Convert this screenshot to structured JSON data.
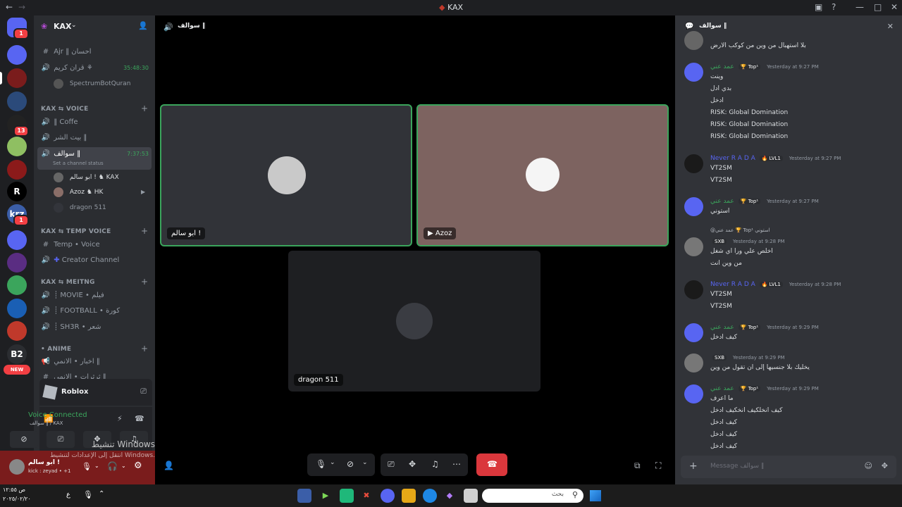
{
  "window": {
    "title": "KAX"
  },
  "rail": {
    "servers": [
      {
        "label": "",
        "badge": "1",
        "color": "#5865f2"
      },
      {
        "label": "",
        "badge": "",
        "color": "#5865f2"
      },
      {
        "label": "",
        "badge": "",
        "color": "#7a1c1c"
      },
      {
        "label": "",
        "badge": "",
        "color": "#2b4a7a"
      },
      {
        "label": "",
        "badge": "13",
        "color": "#222"
      },
      {
        "label": "",
        "badge": "",
        "color": "#8fbf62"
      },
      {
        "label": "",
        "badge": "",
        "color": "#8b1a1a"
      },
      {
        "label": "R",
        "badge": "",
        "color": "#000"
      },
      {
        "label": "krz",
        "badge": "1",
        "color": "#3b5ea8"
      },
      {
        "label": "",
        "badge": "",
        "color": "#5865f2"
      },
      {
        "label": "",
        "badge": "",
        "color": "#5a2d82"
      },
      {
        "label": "",
        "badge": "",
        "color": "#3ba55c"
      },
      {
        "label": "",
        "badge": "",
        "color": "#1a5fb4"
      },
      {
        "label": "",
        "badge": "",
        "color": "#c0392b"
      },
      {
        "label": "B2",
        "badge": "",
        "color": "#2b2d31"
      }
    ],
    "new_label": "NEW"
  },
  "sidebar": {
    "guild_name": "KAX",
    "channels_top": [
      {
        "icon": "#",
        "name": "Ajr ‖ احسان"
      },
      {
        "icon": "voice",
        "name": "قران كريم ⚘",
        "time": "35:48:30"
      },
      {
        "icon": "member",
        "name": "SpectrumBotQuran"
      }
    ],
    "cat_voice": "KAX ⇆ VOICE",
    "voice_channels": [
      {
        "name": "‖ Coffe"
      },
      {
        "name": "بيت الشر ‖"
      },
      {
        "name": "سوالف ‖",
        "time": "7:37:53",
        "status": "Set a channel status"
      }
    ],
    "voice_members": [
      {
        "name": "ابو سالم ! ♞ KAX"
      },
      {
        "name": "Azoz ♞ HK"
      },
      {
        "name": "dragon 511"
      }
    ],
    "cat_temp": "KAX ⇆ TEMP VOICE",
    "temp_channels": [
      {
        "icon": "#",
        "name": "Temp • Voice"
      },
      {
        "icon": "+",
        "name": "Creator Channel"
      }
    ],
    "cat_meeting": "KAX ⇆ MEITNG",
    "meeting_channels": [
      {
        "name": "┊ MOVIE • فيلم"
      },
      {
        "name": "┊ FOOTBALL • كورة"
      },
      {
        "name": "┊ SH3R • شعر"
      }
    ],
    "cat_anime": "• ANIME",
    "anime_channels": [
      {
        "name": "اخبار • الانمي ‖"
      },
      {
        "name": "ثرثرات • الانمي ‖"
      }
    ]
  },
  "activity": {
    "game": "Roblox"
  },
  "voice_panel": {
    "status": "Voice Connected",
    "location": "سوالف ‖ / KAX"
  },
  "windows_watermark": {
    "line1": "تنشيط Windows",
    "line2": "انتقل إلى الإعدادات لتنشيط Windows."
  },
  "user_panel": {
    "name": "ابو سالم !",
    "status": "kick : zeyad • +1"
  },
  "call": {
    "header": "سوالف ‖",
    "tiles": [
      {
        "name": "ابو سالم !"
      },
      {
        "name": "Azoz"
      },
      {
        "name": "dragon 511"
      }
    ]
  },
  "chat": {
    "header": "سوالف ‖",
    "input_placeholder": "Message سوالف ‖",
    "messages": [
      {
        "author": "",
        "time": "",
        "lines": [
          "بلا استهبال من وين من كوكب الارض"
        ]
      },
      {
        "author": "عمد عني",
        "tag": "🏆 Top¹",
        "time": "Yesterday at 9:27 PM",
        "lines": [
          "وينت",
          "بدي ادل",
          "ادخل",
          "RISK: Global Domination",
          "RISK: Global Domination",
          "RISK: Global Domination"
        ]
      },
      {
        "author": "Never R A D A",
        "tag": "🔥 LVL1",
        "time": "Yesterday at 9:27 PM",
        "lines": [
          "VT2SM",
          "VT2SM"
        ]
      },
      {
        "author": "عمد عني",
        "tag": "🏆 Top¹",
        "time": "Yesterday at 9:27 PM",
        "lines": [
          "استوني"
        ]
      },
      {
        "reply": "@عمد عني 🏆 Top¹ استوني",
        "author": "",
        "tag": "SXB",
        "time": "Yesterday at 9:28 PM",
        "lines": [
          "اخلص علي ورا اي شغل",
          "من وين انت"
        ]
      },
      {
        "author": "Never R A D A",
        "tag": "🔥 LVL1",
        "time": "Yesterday at 9:28 PM",
        "lines": [
          "VT2SM",
          "VT2SM"
        ]
      },
      {
        "author": "عمد عني",
        "tag": "🏆 Top¹",
        "time": "Yesterday at 9:29 PM",
        "lines": [
          "كيف ادخل"
        ]
      },
      {
        "author": "",
        "tag": "SXB",
        "time": "Yesterday at 9:29 PM",
        "lines": [
          "يخليك بلا جنسيها إلى ان تقول من وين"
        ]
      },
      {
        "author": "عمد عني",
        "tag": "🏆 Top¹",
        "time": "Yesterday at 9:29 PM",
        "lines": [
          "ما اعرف",
          "كيف انخلكيف انخكيف ادخل",
          "كيف ادخل",
          "كيف ادخل",
          "كيف ادخل"
        ]
      }
    ]
  },
  "taskbar": {
    "clock": "ص ١٢:٥٥",
    "date": "٢٠٢٥/٠٢/٢٠",
    "lang": "ع",
    "search_placeholder": "بحث"
  },
  "colors": {
    "accent": "#5865f2",
    "green": "#3ba55c",
    "hangup": "#da373c",
    "tile_speaking_border": "#3ba55c"
  }
}
